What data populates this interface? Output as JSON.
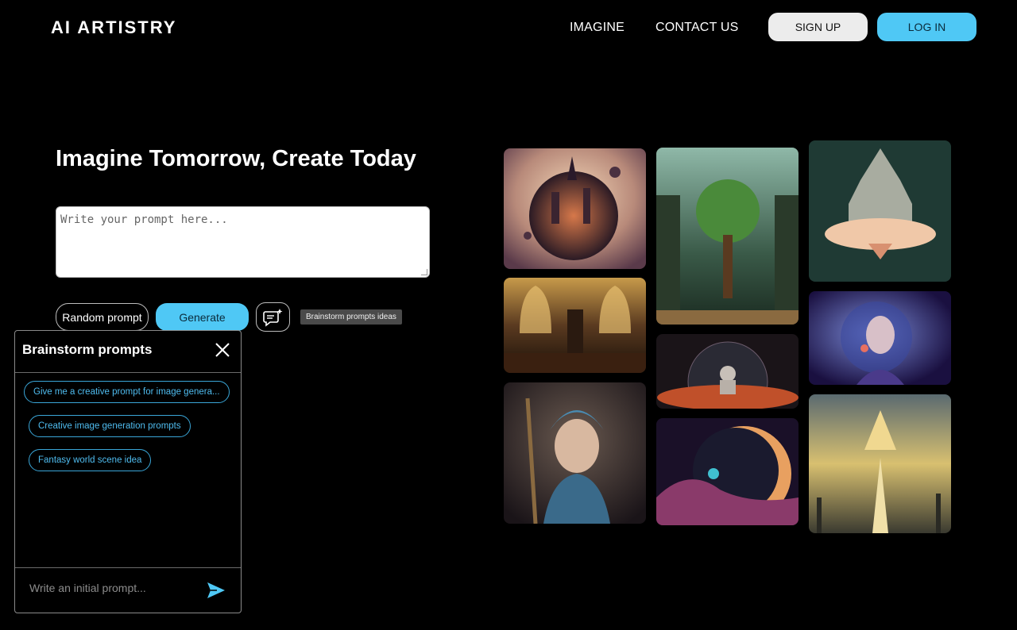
{
  "brand": {
    "name": "AI ARTISTRY"
  },
  "nav": {
    "links": [
      {
        "label": "IMAGINE"
      },
      {
        "label": "CONTACT US"
      }
    ],
    "signup_label": "SIGN UP",
    "login_label": "LOG IN"
  },
  "hero": {
    "headline": "Imagine Tomorrow, Create Today",
    "prompt_placeholder": "Write your prompt here...",
    "random_label": "Random prompt",
    "generate_label": "Generate",
    "brainstorm_tooltip": "Brainstorm prompts ideas"
  },
  "brainstorm": {
    "title": "Brainstorm prompts",
    "suggestions": [
      {
        "label": "Give me a creative prompt for image genera..."
      },
      {
        "label": "Creative image generation prompts"
      },
      {
        "label": "Fantasy world scene idea"
      }
    ],
    "input_placeholder": "Write an initial prompt..."
  },
  "colors": {
    "accent": "#4fc8f5",
    "background": "#000000",
    "chip_border": "#3aa6d8"
  },
  "icons": {
    "brainstorm": "chat-sparkle-icon",
    "close": "close-icon",
    "send": "send-icon"
  }
}
